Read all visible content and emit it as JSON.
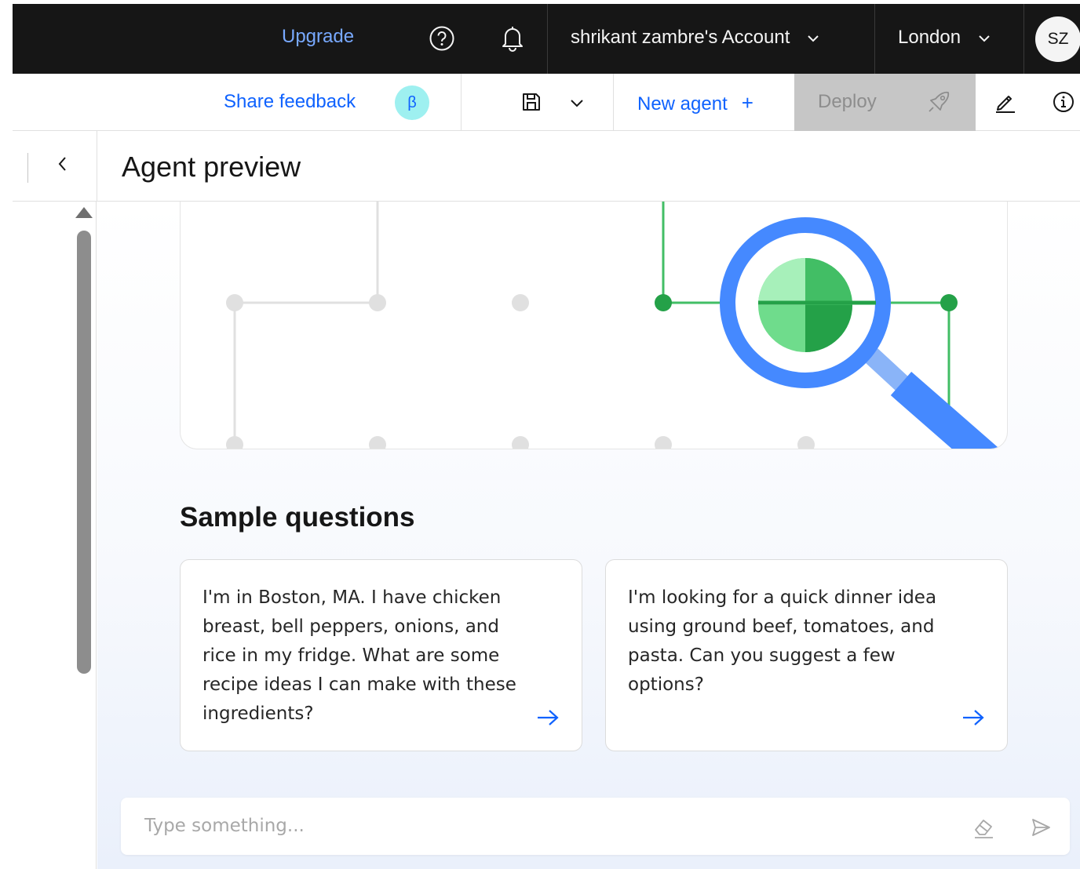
{
  "topbar": {
    "upgrade_label": "Upgrade",
    "help_icon": "help-circle-icon",
    "notification_icon": "bell-icon",
    "account_label": "shrikant zambre's Account",
    "region_label": "London",
    "avatar_initials": "SZ"
  },
  "toolbar": {
    "feedback_label": "Share feedback",
    "beta_badge": "β",
    "save_icon": "save-icon",
    "new_agent_label": "New agent",
    "new_agent_plus": "+",
    "deploy_label": "Deploy",
    "edit_icon": "edit-icon",
    "info_icon": "info-icon"
  },
  "preview": {
    "title": "Agent preview",
    "back_icon": "chevron-left-icon"
  },
  "sample_questions": {
    "heading": "Sample questions",
    "items": [
      {
        "text": "I'm in Boston, MA. I have chicken breast, bell peppers, onions, and rice in my fridge. What are some recipe ideas I can make with these ingredients?"
      },
      {
        "text": "I'm looking for a quick dinner idea using ground beef, tomatoes, and pasta. Can you suggest a few options?"
      }
    ]
  },
  "chat": {
    "placeholder": "Type something..."
  },
  "colors": {
    "topbar_bg": "#161616",
    "link_blue": "#0f62fe",
    "upgrade_blue": "#78a9ff",
    "beta_bg": "#9ef0f0",
    "deploy_disabled_bg": "#c6c6c6",
    "magnifier_blue": "#4589ff",
    "network_green": "#24a148"
  }
}
